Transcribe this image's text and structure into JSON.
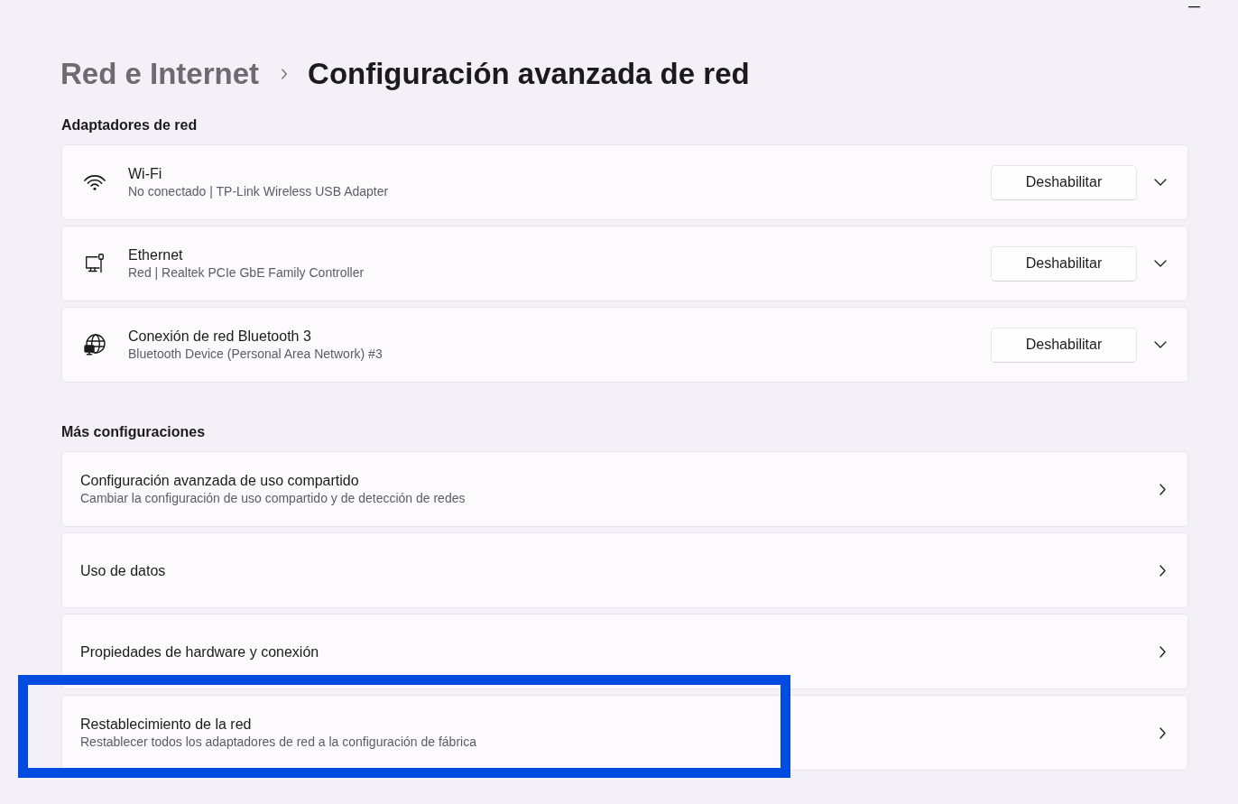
{
  "breadcrumb": {
    "parent": "Red e Internet",
    "current": "Configuración avanzada de red"
  },
  "adapters": {
    "heading": "Adaptadores de red",
    "items": [
      {
        "kind": "wifi",
        "name": "Wi-Fi",
        "detail": "No conectado | TP-Link Wireless USB Adapter",
        "action": "Deshabilitar",
        "expanded": false
      },
      {
        "kind": "ethernet",
        "name": "Ethernet",
        "detail": "Red | Realtek PCIe GbE Family Controller",
        "action": "Deshabilitar",
        "expanded": false
      },
      {
        "kind": "bluetooth",
        "name": "Conexión de red Bluetooth 3",
        "detail": "Bluetooth Device (Personal Area Network) #3",
        "action": "Deshabilitar",
        "expanded": false
      }
    ]
  },
  "more_settings": {
    "heading": "Más configuraciones",
    "items": [
      {
        "title": "Configuración avanzada de uso compartido",
        "description": "Cambiar la configuración de uso compartido y de detección de redes",
        "highlighted": false
      },
      {
        "title": "Uso de datos",
        "highlighted": false
      },
      {
        "title": "Propiedades de hardware y conexión",
        "highlighted": false
      },
      {
        "title": "Restablecimiento de la red",
        "description": "Restablecer todos los adaptadores de red a la configuración de fábrica",
        "highlighted": true
      }
    ]
  }
}
